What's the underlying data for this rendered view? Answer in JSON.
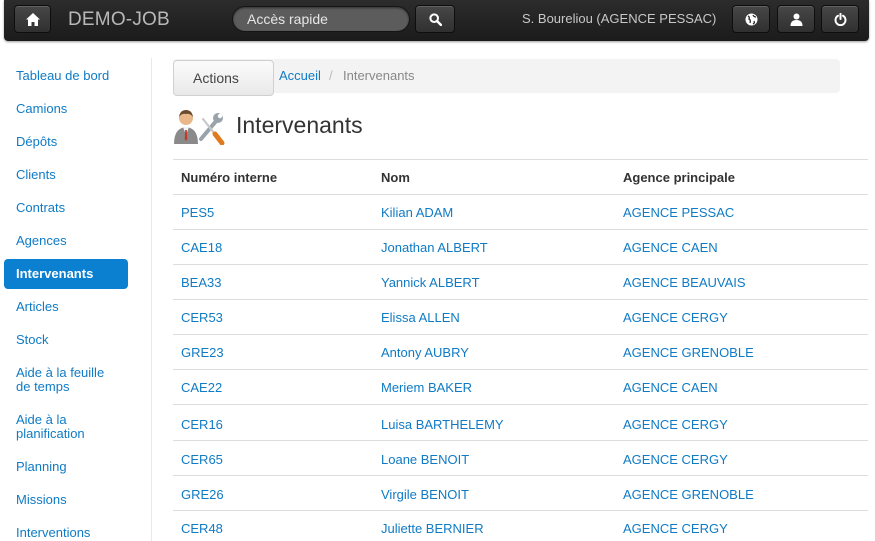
{
  "navbar": {
    "brand": "DEMO-JOB",
    "search_placeholder": "Accès rapide",
    "user": "S. Boureliou (AGENCE PESSAC)"
  },
  "sidebar": {
    "items": [
      {
        "label": "Tableau de bord",
        "active": false
      },
      {
        "label": "Camions",
        "active": false
      },
      {
        "label": "Dépôts",
        "active": false
      },
      {
        "label": "Clients",
        "active": false
      },
      {
        "label": "Contrats",
        "active": false
      },
      {
        "label": "Agences",
        "active": false
      },
      {
        "label": "Intervenants",
        "active": true
      },
      {
        "label": "Articles",
        "active": false
      },
      {
        "label": "Stock",
        "active": false
      },
      {
        "label": "Aide à la feuille de temps",
        "active": false
      },
      {
        "label": "Aide à la planification",
        "active": false
      },
      {
        "label": "Planning",
        "active": false
      },
      {
        "label": "Missions",
        "active": false
      },
      {
        "label": "Interventions",
        "active": false
      }
    ]
  },
  "breadcrumb": {
    "actions_label": "Actions",
    "home": "Accueil",
    "separator": "/",
    "current": "Intervenants"
  },
  "page": {
    "title": "Intervenants"
  },
  "table": {
    "headers": [
      "Numéro interne",
      "Nom",
      "Agence principale"
    ],
    "rows": [
      [
        "PES5",
        "Kilian ADAM",
        "AGENCE PESSAC"
      ],
      [
        "CAE18",
        "Jonathan ALBERT",
        "AGENCE CAEN"
      ],
      [
        "BEA33",
        "Yannick ALBERT",
        "AGENCE BEAUVAIS"
      ],
      [
        "CER53",
        "Elissa ALLEN",
        "AGENCE CERGY"
      ],
      [
        "GRE23",
        "Antony AUBRY",
        "AGENCE GRENOBLE"
      ],
      [
        "CAE22",
        "Meriem BAKER",
        "AGENCE CAEN"
      ],
      [
        "CER16",
        "Luisa BARTHELEMY",
        "AGENCE CERGY"
      ],
      [
        "CER65",
        "Loane BENOIT",
        "AGENCE CERGY"
      ],
      [
        "GRE26",
        "Virgile BENOIT",
        "AGENCE GRENOBLE"
      ],
      [
        "CER48",
        "Juliette BERNIER",
        "AGENCE CERGY"
      ]
    ]
  },
  "colors": {
    "link": "#0f7bc5",
    "active_nav": "#0b7fd0",
    "navbar": "#1b1b1b"
  }
}
